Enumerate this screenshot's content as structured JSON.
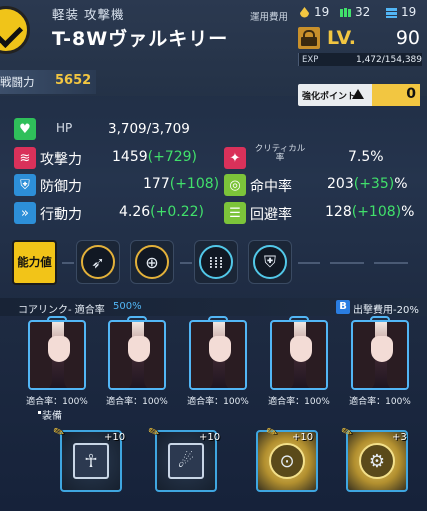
{
  "header": {
    "subtitle": "軽装 攻撃機",
    "unit_name": "T-8Wヴァルキリー",
    "cost_label": "運用費用",
    "costs": [
      {
        "icon": "fuel-icon",
        "value": "19",
        "color": "#f2c641"
      },
      {
        "icon": "ammo-icon",
        "value": "32",
        "color": "#41e06b"
      },
      {
        "icon": "parts-icon",
        "value": "19",
        "color": "#52b6f5"
      }
    ],
    "power_label": "戦闘力",
    "power_value": "5652",
    "lv_label": "LV.",
    "lv_value": "90",
    "exp_label": "EXP",
    "exp_value": "1,472/154,389",
    "exp_fraction": 0.0095,
    "enhance_label": "強化ポイント",
    "enhance_value": "0"
  },
  "stats": {
    "hp": {
      "label": "HP",
      "value": "3,709/3,709"
    },
    "atk": {
      "label": "攻撃力",
      "base": "1459",
      "bonus": "(+729)"
    },
    "def": {
      "label": "防御力",
      "base": "177",
      "bonus": "(+108)"
    },
    "spd": {
      "label": "行動力",
      "base": "4.26",
      "bonus": "(+0.22)"
    },
    "crit": {
      "label": "クリティカル\n率",
      "value": "7.5%"
    },
    "acc": {
      "label": "命中率",
      "base": "203",
      "bonus": "(+35)",
      "unit": "%"
    },
    "eva": {
      "label": "回避率",
      "base": "128",
      "bonus": "(+108)",
      "unit": "%"
    }
  },
  "ability": {
    "label": "能力値",
    "skills": [
      {
        "icon": "missile-icon"
      },
      {
        "icon": "crosshair-icon"
      },
      {
        "icon": "bullets-icon"
      },
      {
        "icon": "shield-icon"
      }
    ]
  },
  "core": {
    "label": "コアリンク- 適合率",
    "rate": "500%",
    "badge": "B",
    "cost_label": "出撃費用-20%",
    "links": [
      {
        "rate": "適合率：100%"
      },
      {
        "rate": "適合率：100%"
      },
      {
        "rate": "適合率：100%"
      },
      {
        "rate": "適合率：100%"
      },
      {
        "rate": "適合率：100%"
      }
    ]
  },
  "equipment": {
    "label": "装備",
    "items": [
      {
        "plus": "+10",
        "icon": "armor-chip-icon"
      },
      {
        "plus": "+10",
        "icon": "claw-chip-icon"
      },
      {
        "plus": "+10",
        "icon": "radar-chip-icon"
      },
      {
        "plus": "+3",
        "icon": "gear-chip-icon"
      }
    ]
  },
  "colors": {
    "accent_gold": "#f2c641",
    "bonus_green": "#41e06b",
    "link_blue": "#52b6f5"
  }
}
